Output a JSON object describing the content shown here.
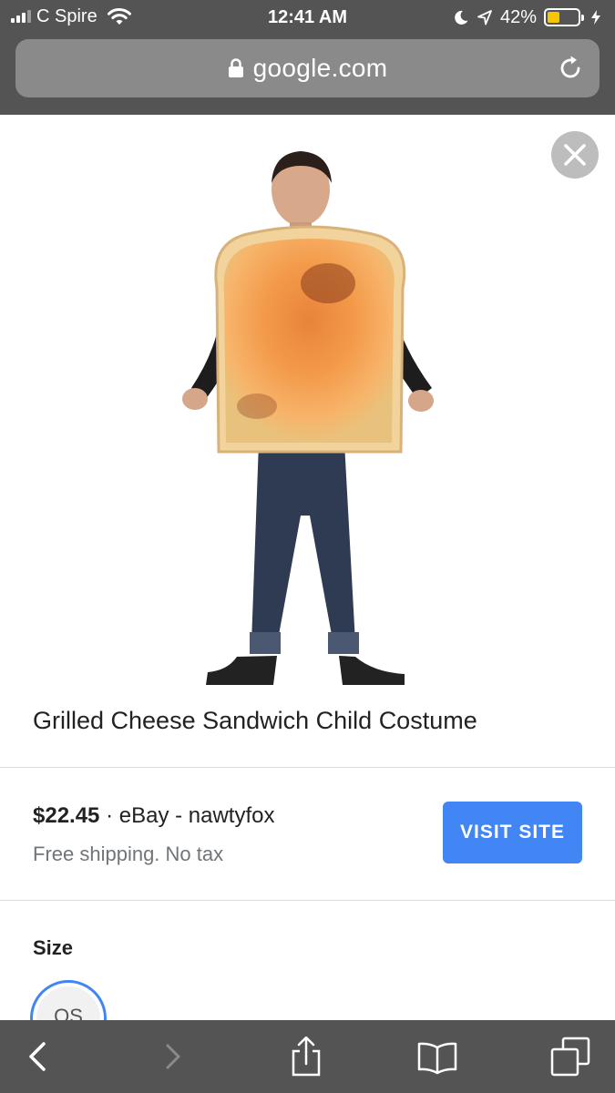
{
  "status_bar": {
    "carrier": "C Spire",
    "time": "12:41 AM",
    "battery_percent": "42%",
    "battery_level": 0.42,
    "signal_bars_active": 3,
    "icons": [
      "signal-icon",
      "wifi-icon",
      "moon-icon",
      "location-arrow-icon",
      "battery-icon",
      "charging-bolt-icon"
    ]
  },
  "browser": {
    "url": "google.com",
    "lock_icon": "lock-icon",
    "reload_icon": "reload-icon"
  },
  "product": {
    "image_icon": "product-photo",
    "close_icon": "close-icon",
    "title": "Grilled Cheese Sandwich Child Costume",
    "price": "$22.45",
    "separator": " · ",
    "seller": "eBay - nawtyfox",
    "shipping": "Free shipping. No tax",
    "visit_button": "VISIT SITE",
    "size_heading": "Size",
    "size_options": [
      "OS"
    ]
  },
  "toolbar": {
    "buttons": [
      "back-icon",
      "forward-icon",
      "share-icon",
      "bookmarks-icon",
      "tabs-icon"
    ]
  },
  "colors": {
    "chrome": "#545454",
    "address_bar": "#8a8a8a",
    "accent_blue": "#4285f4",
    "battery_yellow": "#f6c700"
  }
}
